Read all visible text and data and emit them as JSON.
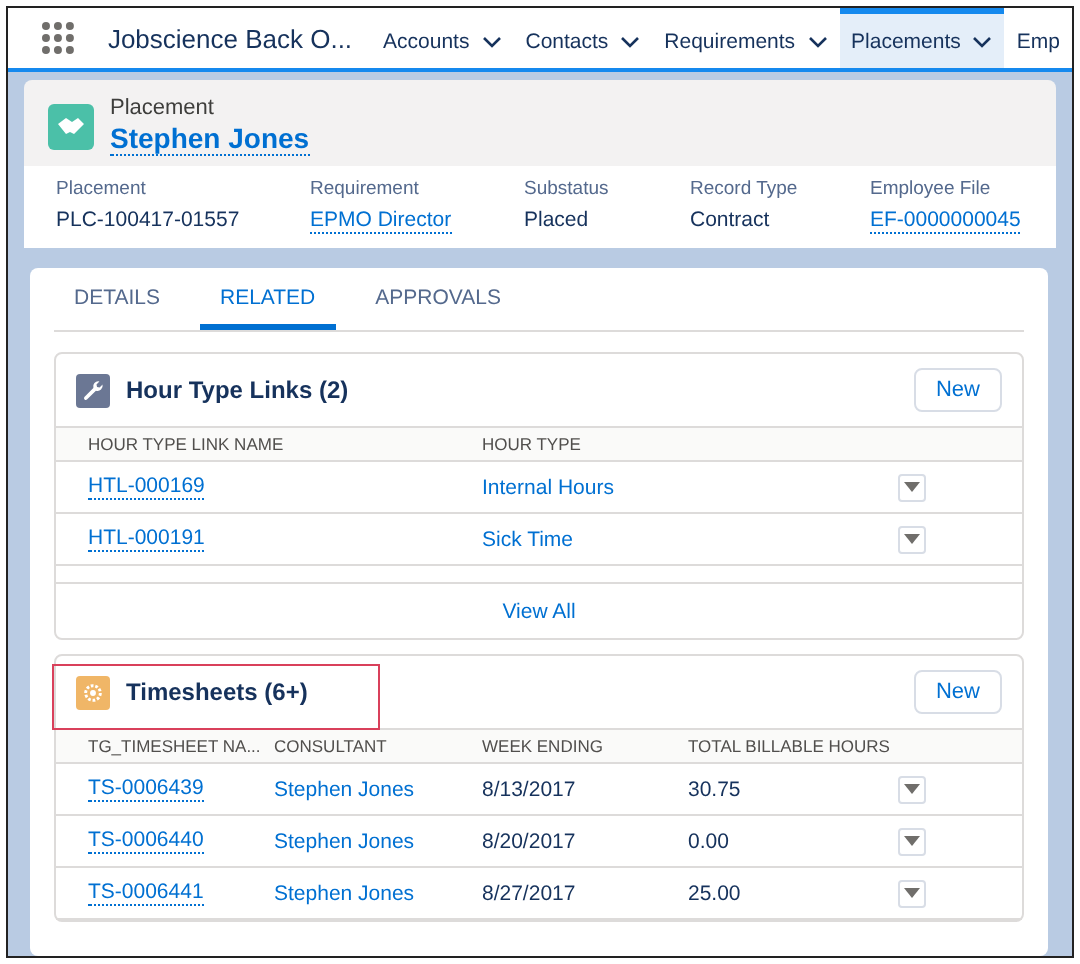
{
  "nav": {
    "app_title": "Jobscience Back O...",
    "items": [
      {
        "label": "Accounts",
        "selected": false,
        "menu": true
      },
      {
        "label": "Contacts",
        "selected": false,
        "menu": true
      },
      {
        "label": "Requirements",
        "selected": false,
        "menu": true
      },
      {
        "label": "Placements",
        "selected": true,
        "menu": true
      },
      {
        "label": "Emp",
        "selected": false,
        "menu": false
      }
    ]
  },
  "header": {
    "object_type": "Placement",
    "name": "Stephen Jones",
    "fields": [
      {
        "label": "Placement",
        "value": "PLC-100417-01557",
        "kind": "text"
      },
      {
        "label": "Requirement",
        "value": "EPMO Director",
        "kind": "record-link"
      },
      {
        "label": "Substatus",
        "value": "Placed",
        "kind": "text"
      },
      {
        "label": "Record Type",
        "value": "Contract",
        "kind": "text"
      },
      {
        "label": "Employee File",
        "value": "EF-0000000045",
        "kind": "record-link"
      }
    ]
  },
  "tabs": [
    {
      "label": "DETAILS",
      "selected": false
    },
    {
      "label": "RELATED",
      "selected": true
    },
    {
      "label": "APPROVALS",
      "selected": false
    }
  ],
  "related_lists": [
    {
      "title": "Hour Type Links (2)",
      "highlighted": false,
      "button": "New",
      "columns": [
        "HOUR TYPE LINK NAME",
        "HOUR TYPE"
      ],
      "footer": "View All",
      "rows": [
        {
          "cells": [
            {
              "text": "HTL-000169",
              "kind": "record-link"
            },
            {
              "text": "Internal Hours",
              "kind": "link"
            }
          ]
        },
        {
          "cells": [
            {
              "text": "HTL-000191",
              "kind": "record-link"
            },
            {
              "text": "Sick Time",
              "kind": "link"
            }
          ]
        }
      ]
    },
    {
      "title": "Timesheets (6+)",
      "highlighted": true,
      "button": "New",
      "columns": [
        "TG_TIMESHEET NA...",
        "CONSULTANT",
        "WEEK ENDING",
        "TOTAL BILLABLE HOURS"
      ],
      "rows": [
        {
          "cells": [
            {
              "text": "TS-0006439",
              "kind": "record-link"
            },
            {
              "text": "Stephen Jones",
              "kind": "link"
            },
            {
              "text": "8/13/2017",
              "kind": "text"
            },
            {
              "text": "30.75",
              "kind": "text"
            }
          ]
        },
        {
          "cells": [
            {
              "text": "TS-0006440",
              "kind": "record-link"
            },
            {
              "text": "Stephen Jones",
              "kind": "link"
            },
            {
              "text": "8/20/2017",
              "kind": "text"
            },
            {
              "text": "0.00",
              "kind": "text"
            }
          ]
        },
        {
          "cells": [
            {
              "text": "TS-0006441",
              "kind": "record-link"
            },
            {
              "text": "Stephen Jones",
              "kind": "link"
            },
            {
              "text": "8/27/2017",
              "kind": "text"
            },
            {
              "text": "25.00",
              "kind": "text"
            }
          ]
        }
      ]
    }
  ]
}
